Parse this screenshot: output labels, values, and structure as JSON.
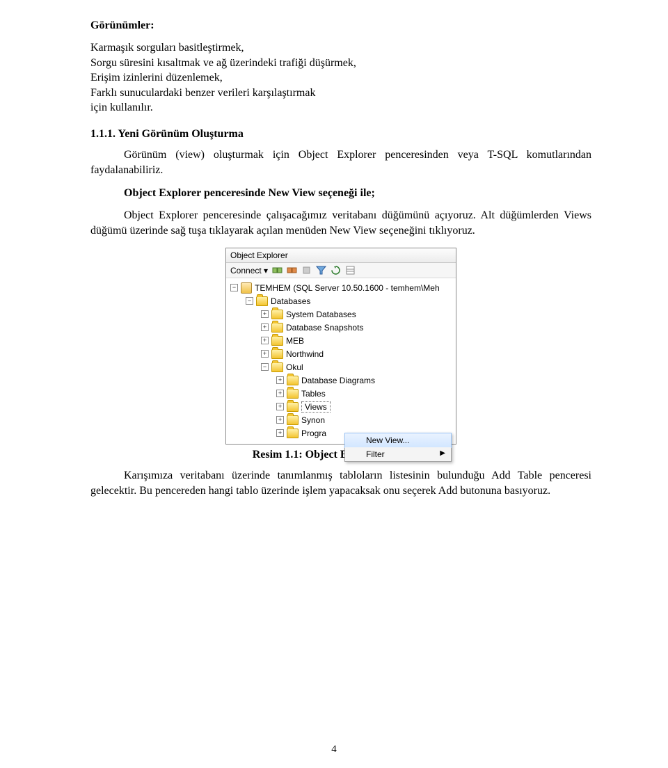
{
  "doc": {
    "heading": "Görünümler:",
    "bullets_text": "Karmaşık sorguları basitleştirmek,\nSorgu süresini kısaltmak ve ağ üzerindeki trafiği düşürmek,\nErişim izinlerini düzenlemek,\nFarklı sunuculardaki benzer verileri karşılaştırmak\niçin kullanılır.",
    "section_number": "1.1.1. Yeni Görünüm Oluşturma",
    "para1": "Görünüm (view) oluşturmak için Object Explorer penceresinden veya T-SQL komutlarından faydalanabiliriz.",
    "bold_line": "Object Explorer penceresinde New View seçeneği ile;",
    "para2": "Object Explorer penceresinde çalışacağımız veritabanı düğümünü açıyoruz. Alt düğümlerden Views düğümü üzerinde sağ tuşa tıklayarak açılan menüden New View seçeneğini tıklıyoruz.",
    "caption": "Resim 1.1: Object Explorer penceresi",
    "para3": "Karışımıza veritabanı üzerinde tanımlanmış tabloların listesinin bulunduğu Add Table penceresi gelecektir. Bu pencereden hangi tablo üzerinde işlem yapacaksak onu seçerek Add butonuna basıyoruz.",
    "page_number": "4"
  },
  "screenshot": {
    "title": "Object Explorer",
    "connect_label": "Connect ▾",
    "root": "TEMHEM (SQL Server 10.50.1600 - temhem\\Meh",
    "databases": "Databases",
    "system_db": "System Databases",
    "snapshots": "Database Snapshots",
    "meb": "MEB",
    "northwind": "Northwind",
    "okul": "Okul",
    "diagrams": "Database Diagrams",
    "tables": "Tables",
    "views": "Views",
    "synon": "Synon",
    "progra": "Progra",
    "menu_new_view": "New View...",
    "menu_filter": "Filter"
  }
}
